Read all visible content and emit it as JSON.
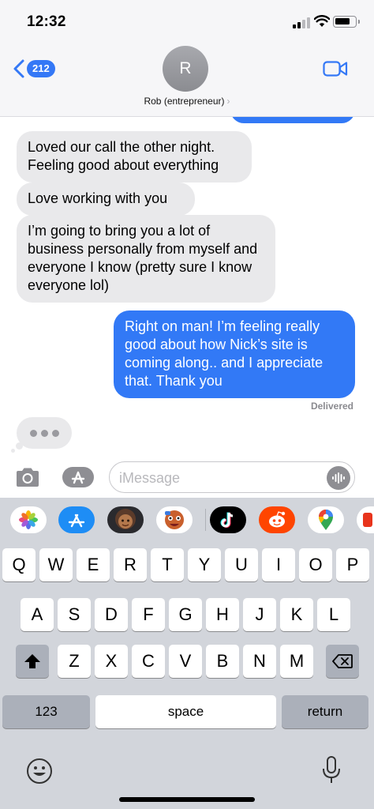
{
  "status_bar": {
    "time": "12:32"
  },
  "header": {
    "back_count": "212",
    "avatar_initial": "R",
    "contact_name": "Rob (entrepreneur)",
    "contact_chevron": "›"
  },
  "messages": [
    {
      "direction": "incoming",
      "text": "Loved our call the other night. Feeling good about everything"
    },
    {
      "direction": "incoming",
      "text": "Love working with you"
    },
    {
      "direction": "incoming",
      "text": "I’m going to bring you a lot of business personally from myself and everyone I know (pretty sure I know everyone lol)"
    },
    {
      "direction": "outgoing",
      "text": "Right on man! I’m feeling really good about how Nick’s site is coming along.. and I appreciate that. Thank you"
    }
  ],
  "delivery_status": "Delivered",
  "composer": {
    "placeholder": "iMessage",
    "value": ""
  },
  "app_strip": {
    "icons": [
      "photos-icon",
      "app-store-icon",
      "memoji-icon",
      "animoji-icon",
      "tiktok-icon",
      "reddit-icon",
      "google-maps-icon",
      "partial-app-icon"
    ]
  },
  "keyboard": {
    "row1": [
      "Q",
      "W",
      "E",
      "R",
      "T",
      "Y",
      "U",
      "I",
      "O",
      "P"
    ],
    "row2": [
      "A",
      "S",
      "D",
      "F",
      "G",
      "H",
      "J",
      "K",
      "L"
    ],
    "row3": [
      "Z",
      "X",
      "C",
      "V",
      "B",
      "N",
      "M"
    ],
    "numbers_label": "123",
    "space_label": "space",
    "return_label": "return"
  },
  "colors": {
    "outgoing_bubble": "#3279f6",
    "incoming_bubble": "#e9e9eb",
    "accent": "#3478f6",
    "keyboard_bg": "#d2d5db"
  }
}
